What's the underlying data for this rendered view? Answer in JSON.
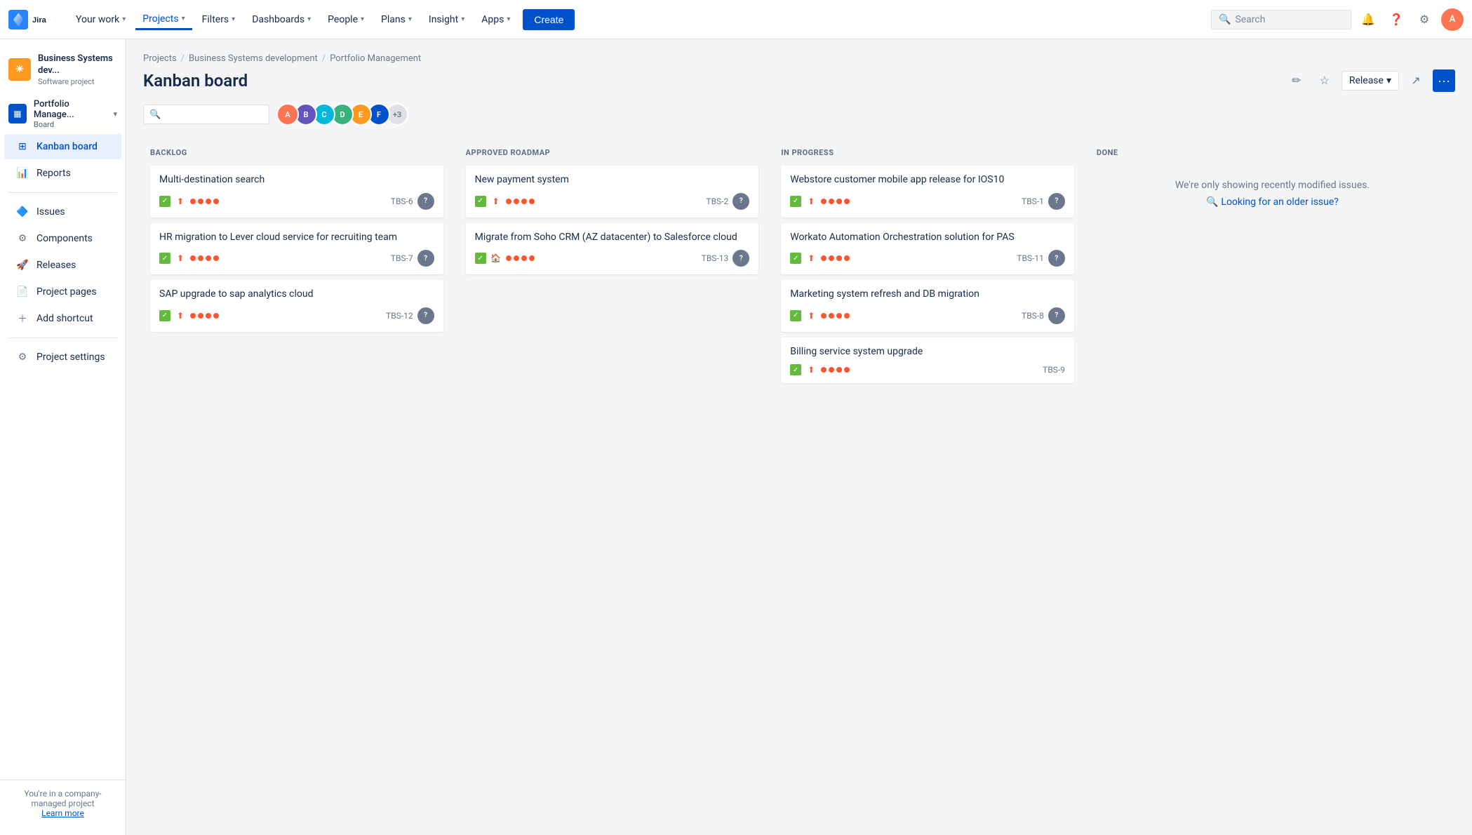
{
  "topnav": {
    "logo_text": "Jira",
    "items": [
      {
        "id": "your-work",
        "label": "Your work",
        "has_chevron": true,
        "active": false
      },
      {
        "id": "projects",
        "label": "Projects",
        "has_chevron": true,
        "active": true
      },
      {
        "id": "filters",
        "label": "Filters",
        "has_chevron": true,
        "active": false
      },
      {
        "id": "dashboards",
        "label": "Dashboards",
        "has_chevron": true,
        "active": false
      },
      {
        "id": "people",
        "label": "People",
        "has_chevron": true,
        "active": false
      },
      {
        "id": "plans",
        "label": "Plans",
        "has_chevron": true,
        "active": false
      },
      {
        "id": "insight",
        "label": "Insight",
        "has_chevron": true,
        "active": false
      },
      {
        "id": "apps",
        "label": "Apps",
        "has_chevron": true,
        "active": false
      }
    ],
    "create_label": "Create",
    "search_placeholder": "Search"
  },
  "sidebar": {
    "project1": {
      "name": "Business Systems dev...",
      "type": "Software project",
      "icon": "B"
    },
    "project2": {
      "name": "Portfolio Manage...",
      "type": "Board",
      "icon": "P"
    },
    "nav_items": [
      {
        "id": "kanban-board",
        "label": "Kanban board",
        "active": true,
        "icon": "⊞"
      },
      {
        "id": "reports",
        "label": "Reports",
        "active": false,
        "icon": "📈"
      },
      {
        "id": "issues",
        "label": "Issues",
        "active": false,
        "icon": "🔷"
      },
      {
        "id": "components",
        "label": "Components",
        "active": false,
        "icon": "⚙"
      },
      {
        "id": "releases",
        "label": "Releases",
        "active": false,
        "icon": "🚀"
      },
      {
        "id": "project-pages",
        "label": "Project pages",
        "active": false,
        "icon": "📄"
      },
      {
        "id": "add-shortcut",
        "label": "Add shortcut",
        "active": false,
        "icon": "+"
      },
      {
        "id": "project-settings",
        "label": "Project settings",
        "active": false,
        "icon": "⚙"
      }
    ],
    "footer_text": "You're in a company-managed project",
    "learn_more": "Learn more"
  },
  "breadcrumb": {
    "items": [
      "Projects",
      "Business Systems development",
      "Portfolio Management"
    ]
  },
  "page": {
    "title": "Kanban board",
    "release_label": "Release",
    "release_chevron": "▾"
  },
  "filter_bar": {
    "search_placeholder": "",
    "avatars": [
      {
        "color": "#ff7452",
        "initials": "A"
      },
      {
        "color": "#6554c0",
        "initials": "B"
      },
      {
        "color": "#00b8d9",
        "initials": "C"
      },
      {
        "color": "#36b37e",
        "initials": "D"
      },
      {
        "color": "#ff991f",
        "initials": "E"
      },
      {
        "color": "#0052cc",
        "initials": "F"
      }
    ],
    "extra_count": "+3"
  },
  "columns": [
    {
      "id": "backlog",
      "header": "BACKLOG",
      "cards": [
        {
          "id": "c1",
          "title": "Multi-destination search",
          "ticket": "TBS-6",
          "priority": "highest"
        },
        {
          "id": "c2",
          "title": "HR migration to Lever cloud service for recruiting team",
          "ticket": "TBS-7",
          "priority": "highest"
        },
        {
          "id": "c3",
          "title": "SAP upgrade to sap analytics cloud",
          "ticket": "TBS-12",
          "priority": "highest"
        }
      ]
    },
    {
      "id": "approved-roadmap",
      "header": "APPROVED ROADMAP",
      "cards": [
        {
          "id": "c4",
          "title": "New payment system",
          "ticket": "TBS-2",
          "priority": "highest"
        },
        {
          "id": "c5",
          "title": "Migrate from Soho CRM (AZ datacenter) to Salesforce cloud",
          "ticket": "TBS-13",
          "priority": "high"
        }
      ]
    },
    {
      "id": "in-progress",
      "header": "IN PROGRESS",
      "cards": [
        {
          "id": "c6",
          "title": "Webstore customer mobile app release for IOS10",
          "ticket": "TBS-1",
          "priority": "highest"
        },
        {
          "id": "c7",
          "title": "Workato Automation Orchestration solution for PAS",
          "ticket": "TBS-11",
          "priority": "highest"
        },
        {
          "id": "c8",
          "title": "Marketing system refresh and DB migration",
          "ticket": "TBS-8",
          "priority": "highest"
        },
        {
          "id": "c9",
          "title": "Billing service system upgrade",
          "ticket": "TBS-9",
          "priority": "highest"
        }
      ]
    },
    {
      "id": "done",
      "header": "DONE",
      "empty_text": "We're only showing recently modified issues.",
      "older_issue_link": "Looking for an older issue?"
    }
  ]
}
